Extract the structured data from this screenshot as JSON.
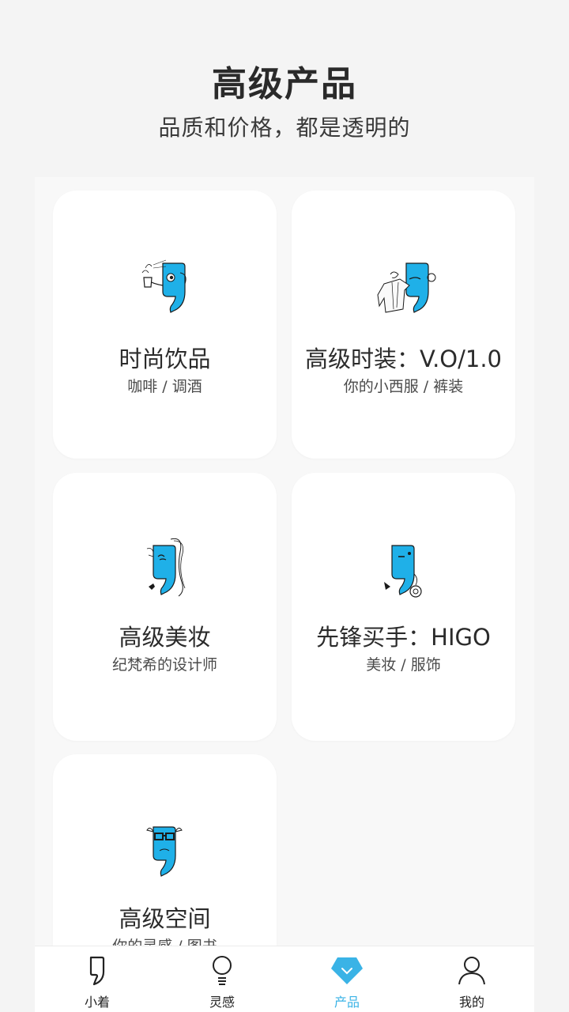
{
  "header": {
    "title": "高级产品",
    "subtitle": "品质和价格，都是透明的"
  },
  "cards": [
    {
      "title": "时尚饮品",
      "subtitle": "咖啡 / 调酒",
      "icon": "mascot-coffee-icon"
    },
    {
      "title": "高级时装：V.O/1.0",
      "subtitle": "你的小西服 / 裤装",
      "icon": "mascot-suit-icon"
    },
    {
      "title": "高级美妆",
      "subtitle": "纪梵希的设计师",
      "icon": "mascot-makeup-icon"
    },
    {
      "title": "先锋买手：HIGO",
      "subtitle": "美妆 / 服饰",
      "icon": "mascot-buyer-icon"
    },
    {
      "title": "高级空间",
      "subtitle": "你的灵感 / 图书",
      "icon": "mascot-space-icon"
    }
  ],
  "tabbar": {
    "active_color": "#3ab3e6",
    "items": [
      {
        "label": "小着",
        "icon": "comma-icon"
      },
      {
        "label": "灵感",
        "icon": "lightbulb-icon"
      },
      {
        "label": "产品",
        "icon": "diamond-icon",
        "active": true
      },
      {
        "label": "我的",
        "icon": "person-icon"
      }
    ]
  },
  "colors": {
    "accent": "#3ab3e6",
    "mascot": "#1fb0e8"
  }
}
